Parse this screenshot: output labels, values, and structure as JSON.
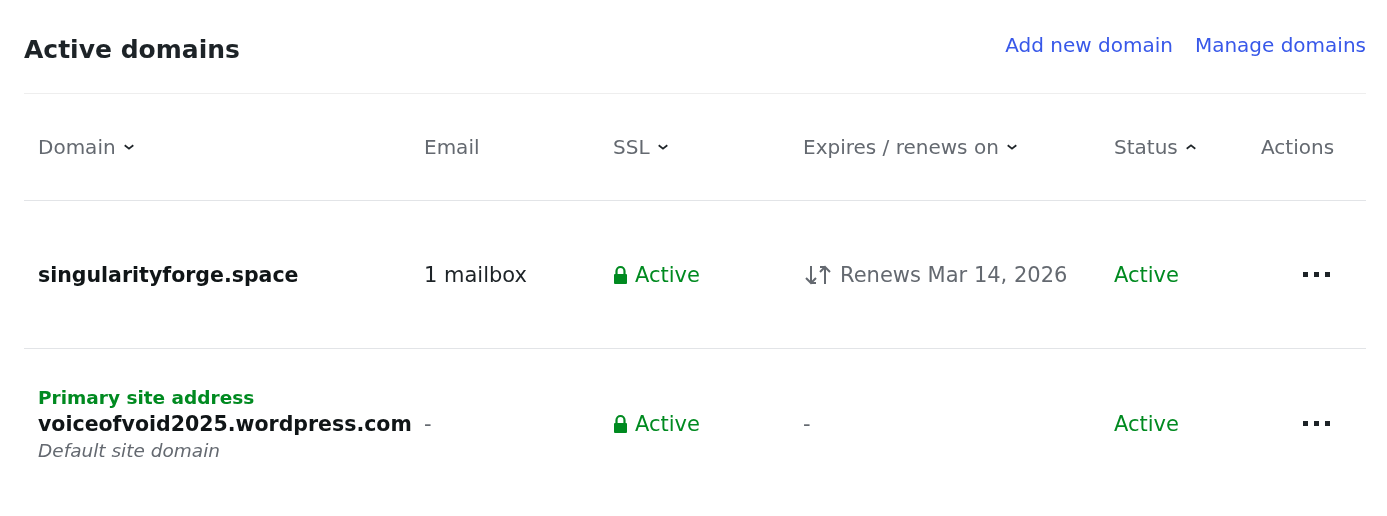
{
  "title": "Active domains",
  "links": [
    "Add new domain",
    "Manage domains"
  ],
  "table": {
    "columns": [
      {
        "label": "Domain",
        "sorted": true,
        "ascending": false
      },
      {
        "label": "Email",
        "sorted": false
      },
      {
        "label": "SSL",
        "sorted": true,
        "ascending": false
      },
      {
        "label": "Expires / renews on",
        "sorted": true,
        "ascending": false
      },
      {
        "label": "Status",
        "sorted": true,
        "ascending": true
      },
      {
        "label": "Actions",
        "sorted": false
      }
    ],
    "rows": [
      {
        "domain": "singularityforge.space",
        "email": "1 mailbox",
        "ssl": "Active",
        "renewal": {
          "text": "Renews Mar 14, 2026",
          "auto_renew": true
        },
        "status": "Active"
      },
      {
        "badge": "Primary site address",
        "domain": "voiceofvoid2025.wordpress.com",
        "note": "Default site domain",
        "email": "-",
        "ssl": "Active",
        "renewal": {
          "text": "-",
          "auto_renew": false
        },
        "status": "Active"
      }
    ]
  }
}
